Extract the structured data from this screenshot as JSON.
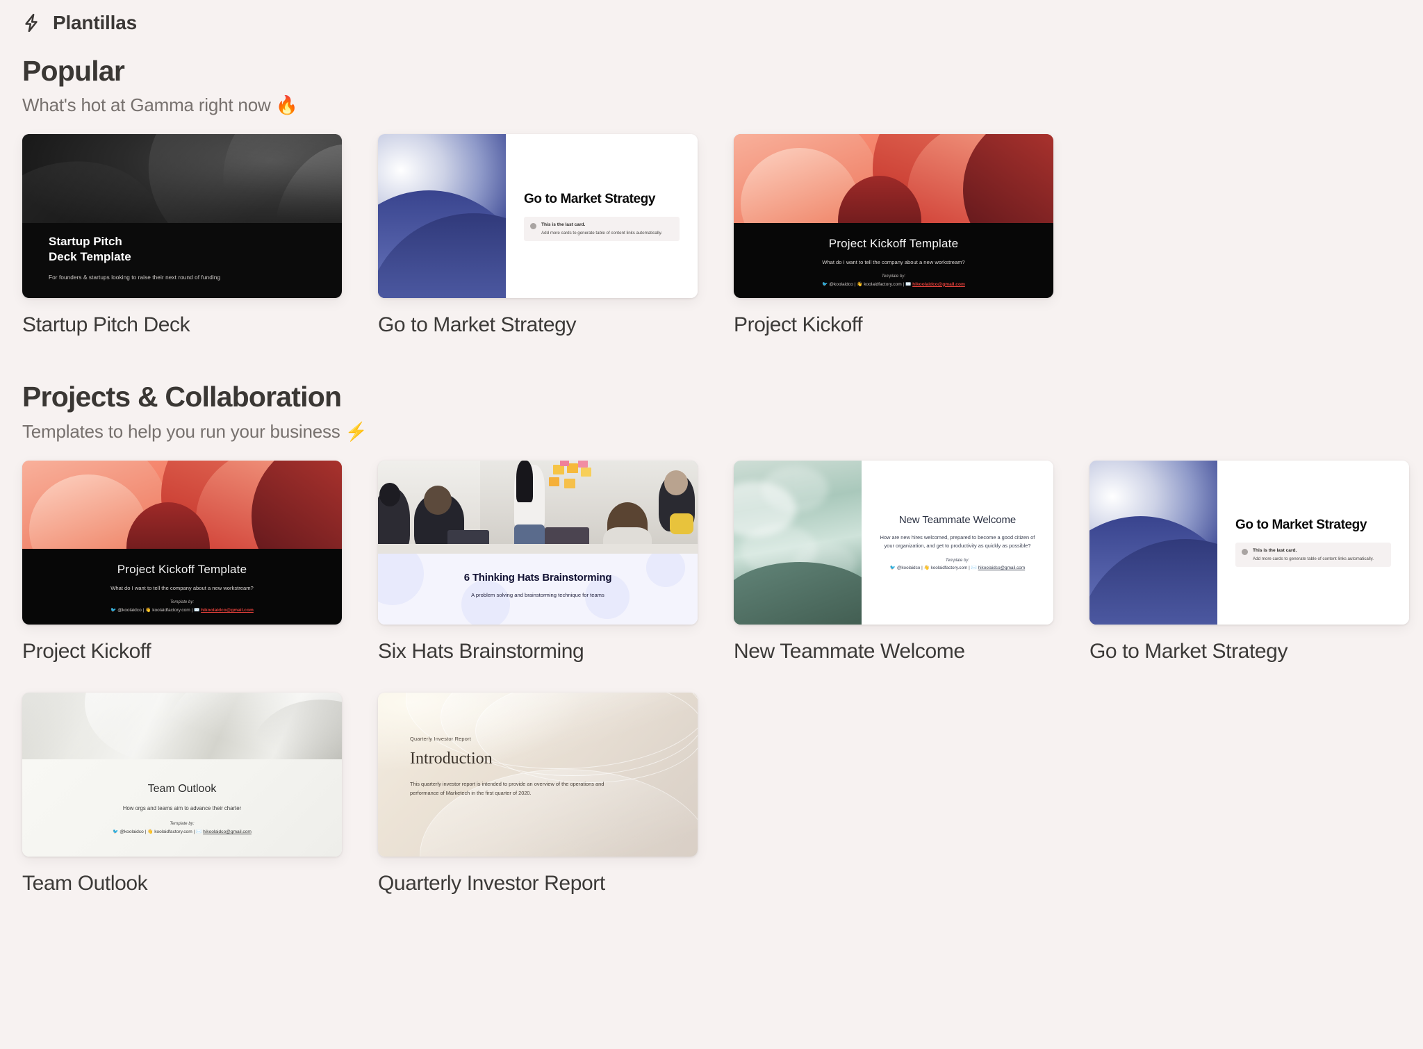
{
  "topbar": {
    "icon": "zap-icon",
    "title": "Plantillas"
  },
  "sections": [
    {
      "id": "popular",
      "title": "Popular",
      "subtitle": "What's hot at Gamma right now 🔥",
      "cards": [
        {
          "label": "Startup Pitch Deck",
          "thumb": "startup-pitch-deck",
          "thumb_title": "Startup Pitch\nDeck Template",
          "thumb_title_line1": "Startup Pitch",
          "thumb_title_line2": "Deck Template",
          "thumb_sub": "For founders & startups looking to raise their next round of funding"
        },
        {
          "label": "Go to Market Strategy",
          "thumb": "go-to-market-strategy",
          "thumb_title": "Go to Market Strategy",
          "note_title": "This is the last card.",
          "note_sub": "Add more cards to generate table of content links automatically."
        },
        {
          "label": "Project Kickoff",
          "thumb": "project-kickoff",
          "thumb_title": "Project Kickoff Template",
          "thumb_sub": "What do I want to tell the company about a new workstream?",
          "credit_by": "Template by:",
          "credit_handle": "@koolaidco",
          "credit_site": "koolaidfactory.com",
          "credit_mail": "hikoolaidco@gmail.com"
        }
      ]
    },
    {
      "id": "projects-collaboration",
      "title": "Projects & Collaboration",
      "subtitle": "Templates to help you run your business ⚡",
      "cards": [
        {
          "label": "Project Kickoff",
          "thumb": "project-kickoff",
          "thumb_title": "Project Kickoff Template",
          "thumb_sub": "What do I want to tell the company about a new workstream?",
          "credit_by": "Template by:",
          "credit_handle": "@koolaidco",
          "credit_site": "koolaidfactory.com",
          "credit_mail": "hikoolaidco@gmail.com"
        },
        {
          "label": "Six Hats Brainstorming",
          "thumb": "six-hats-brainstorming",
          "thumb_title": "6 Thinking Hats Brainstorming",
          "thumb_sub": "A problem solving and brainstorming technique for teams"
        },
        {
          "label": "New Teammate Welcome",
          "thumb": "new-teammate-welcome",
          "thumb_title": "New Teammate Welcome",
          "thumb_sub": "How are new hires welcomed, prepared to become a good citizen of your organization, and get to productivity as quickly as possible?",
          "credit_by": "Template by:",
          "credit_handle": "@koolaidco",
          "credit_site": "koolaidfactory.com",
          "credit_mail": "hikoolaidco@gmail.com"
        },
        {
          "label": "Go to Market Strategy",
          "thumb": "go-to-market-strategy",
          "thumb_title": "Go to Market Strategy",
          "note_title": "This is the last card.",
          "note_sub": "Add more cards to generate table of content links automatically."
        },
        {
          "label": "Team Outlook",
          "thumb": "team-outlook",
          "thumb_title": "Team Outlook",
          "thumb_sub": "How orgs and teams aim to advance their charter",
          "credit_by": "Template by:",
          "credit_handle": "@koolaidco",
          "credit_site": "koolaidfactory.com",
          "credit_mail": "hikoolaidco@gmail.com"
        },
        {
          "label": "Quarterly Investor Report",
          "thumb": "quarterly-investor-report",
          "thumb_kicker": "Quarterly Investor Report",
          "thumb_title": "Introduction",
          "thumb_sub": "This quarterly investor report is intended to provide an overview of the operations and performance of Marketech in the first quarter of 2020."
        }
      ]
    }
  ],
  "colors": {
    "page_bg": "#f7f2f1",
    "heading": "#3a3734",
    "subtext": "#77716e",
    "card_label": "#3c3a38",
    "accent_red": "#e3403a"
  }
}
